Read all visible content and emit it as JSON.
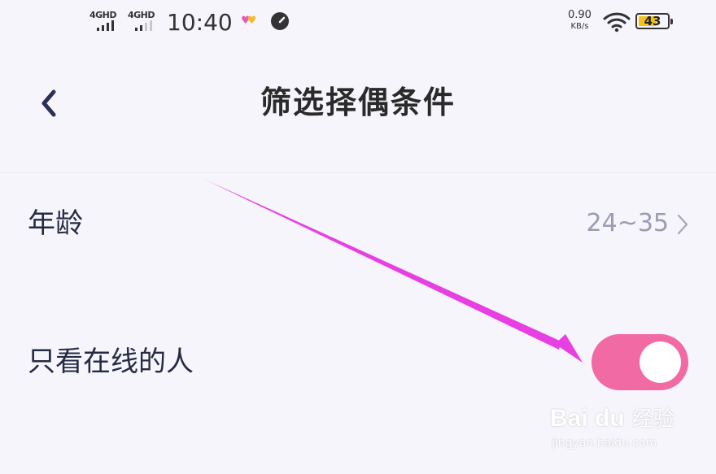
{
  "status_bar": {
    "signal1": "4GHD",
    "signal2": "4GHD",
    "time": "10:40",
    "net_speed": "0.90",
    "net_unit": "KB/s",
    "battery": "43",
    "icons": [
      "signal-icon",
      "signal-icon",
      "hearts-icon",
      "gauge-icon",
      "wifi-icon",
      "battery-icon"
    ]
  },
  "nav": {
    "title": "筛选择偶条件",
    "back_icon": "chevron-left-icon"
  },
  "filters": {
    "age": {
      "label": "年龄",
      "value": "24~35",
      "icon": "chevron-right-icon"
    },
    "online_only": {
      "label": "只看在线的人",
      "enabled": true
    }
  },
  "watermark": {
    "brand": "Bai du",
    "cn": "经验",
    "url": "jingyan.baidu.com"
  },
  "colors": {
    "background": "#f6f5fb",
    "toggle_on": "#f16aa3",
    "annotation_arrow": "#e83fe3",
    "value_text": "#9a9db0"
  }
}
